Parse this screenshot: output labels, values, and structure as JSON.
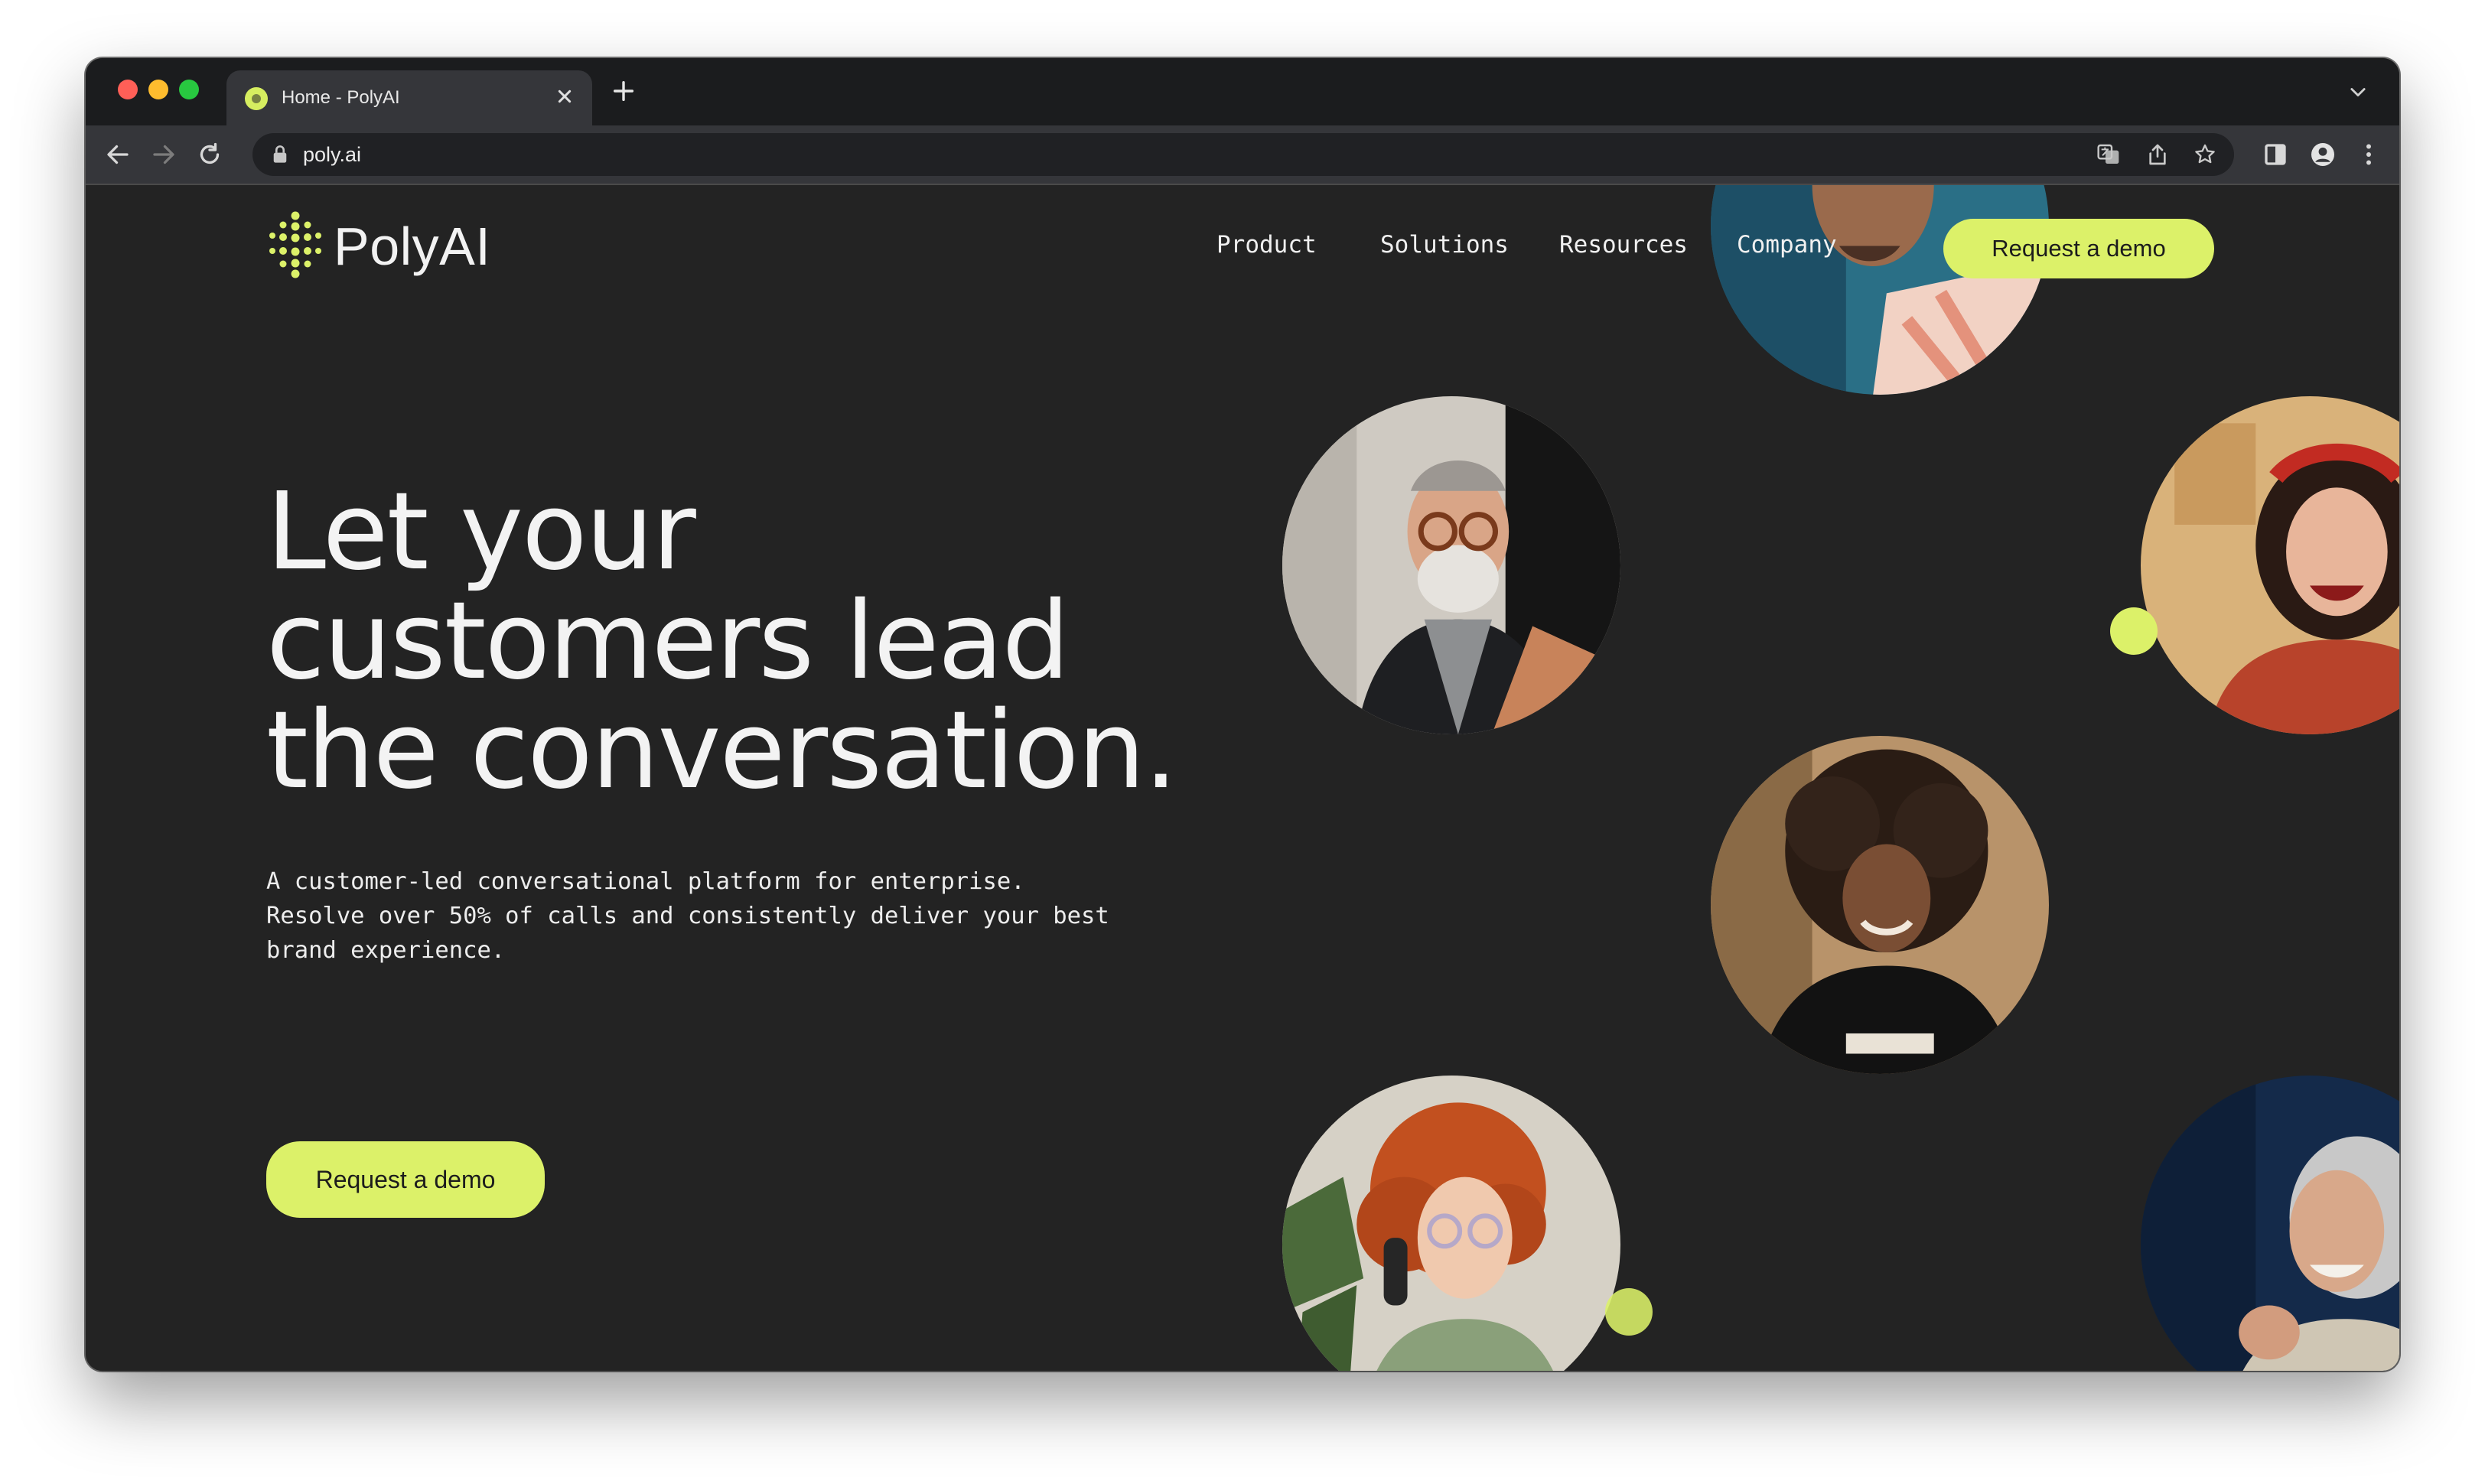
{
  "browser": {
    "tab_title": "Home - PolyAI",
    "url": "poly.ai"
  },
  "site": {
    "logo_text": "PolyAI",
    "nav": [
      {
        "label": "Product"
      },
      {
        "label": "Solutions"
      },
      {
        "label": "Resources"
      },
      {
        "label": "Company"
      }
    ],
    "nav_cta": "Request a demo"
  },
  "hero": {
    "title_lines": [
      "Let your",
      "customers lead",
      "the conversation."
    ],
    "subtitle_lines": [
      "A customer-led conversational platform for enterprise.",
      "Resolve over 50% of calls and consistently deliver your best",
      "brand experience."
    ],
    "cta": "Request a demo"
  },
  "colors": {
    "background": "#232323",
    "accent": "#dcf169",
    "text": "#f3f3f3"
  },
  "icons": [
    "back-arrow-icon",
    "forward-arrow-icon",
    "reload-icon",
    "lock-icon",
    "translate-icon",
    "share-icon",
    "bookmark-star-icon",
    "side-panel-icon",
    "profile-icon",
    "more-menu-icon",
    "close-icon",
    "plus-icon",
    "chevron-down-icon"
  ]
}
